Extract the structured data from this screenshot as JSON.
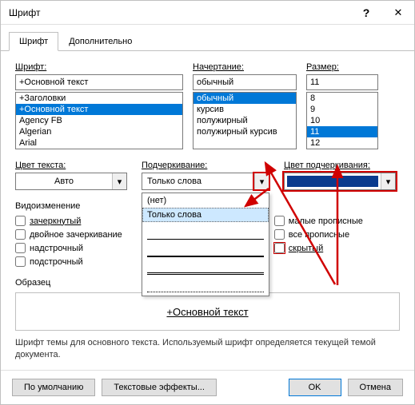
{
  "title": "Шрифт",
  "tabs": {
    "font": "Шрифт",
    "advanced": "Дополнительно"
  },
  "labels": {
    "font": "Шрифт:",
    "style": "Начертание:",
    "size": "Размер:",
    "textColor": "Цвет текста:",
    "underline": "Подчеркивание:",
    "underlineColor": "Цвет подчеркивания:",
    "effects": "Видоизменение",
    "sample": "Образец"
  },
  "font": {
    "value": "+Основной текст",
    "items": [
      "+Заголовки",
      "+Основной текст",
      "Agency FB",
      "Algerian",
      "Arial"
    ]
  },
  "style": {
    "value": "обычный",
    "items": [
      "обычный",
      "курсив",
      "полужирный",
      "полужирный курсив"
    ]
  },
  "size": {
    "value": "11",
    "items": [
      "8",
      "9",
      "10",
      "11",
      "12"
    ]
  },
  "textColor": {
    "value": "Авто"
  },
  "underline": {
    "value": "Только слова",
    "dropdown": {
      "none": "(нет)",
      "wordsOnly": "Только слова"
    }
  },
  "underlineColor": {
    "swatch": "#0a3b8e"
  },
  "checks": {
    "left": [
      "зачеркнутый",
      "двойное зачеркивание",
      "надстрочный",
      "подстрочный"
    ],
    "right": [
      "малые прописные",
      "все прописные",
      "скрытый"
    ]
  },
  "preview": "+Основной текст",
  "desc": "Шрифт темы для основного текста. Используемый шрифт определяется текущей темой документа.",
  "buttons": {
    "defaults": "По умолчанию",
    "textEffects": "Текстовые эффекты...",
    "ok": "OK",
    "cancel": "Отмена"
  }
}
